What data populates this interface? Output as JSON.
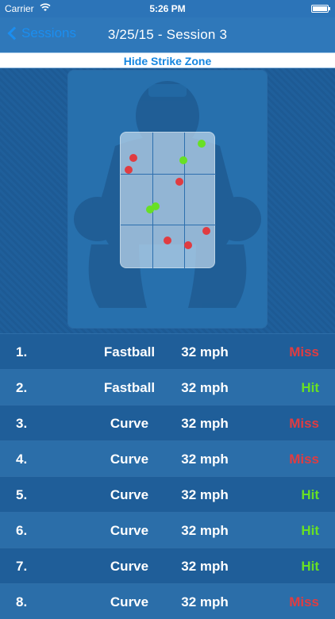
{
  "status_bar": {
    "carrier": "Carrier",
    "time": "5:26 PM"
  },
  "nav": {
    "back_label": "Sessions",
    "title": "3/25/15 - Session 3"
  },
  "toggle": {
    "label": "Hide Strike Zone"
  },
  "colors": {
    "miss": "#e03c41",
    "hit": "#68e024",
    "accent": "#1586e0"
  },
  "pitches": [
    {
      "num": "1.",
      "type": "Fastball",
      "speed": "32 mph",
      "result": "Miss"
    },
    {
      "num": "2.",
      "type": "Fastball",
      "speed": "32 mph",
      "result": "Hit"
    },
    {
      "num": "3.",
      "type": "Curve",
      "speed": "32 mph",
      "result": "Miss"
    },
    {
      "num": "4.",
      "type": "Curve",
      "speed": "32 mph",
      "result": "Miss"
    },
    {
      "num": "5.",
      "type": "Curve",
      "speed": "32 mph",
      "result": "Hit"
    },
    {
      "num": "6.",
      "type": "Curve",
      "speed": "32 mph",
      "result": "Hit"
    },
    {
      "num": "7.",
      "type": "Curve",
      "speed": "32 mph",
      "result": "Hit"
    },
    {
      "num": "8.",
      "type": "Curve",
      "speed": "32 mph",
      "result": "Miss"
    }
  ]
}
